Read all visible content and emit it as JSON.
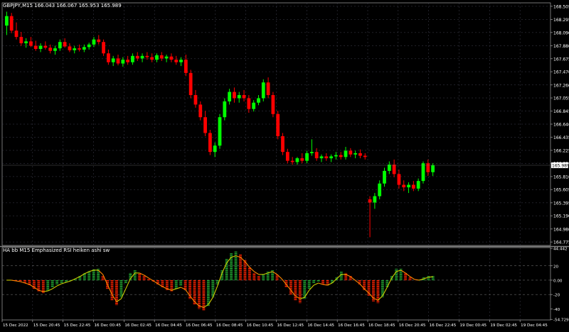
{
  "chart_data": [
    {
      "type": "candlestick",
      "title": "GBPJPY,M15  166.043 166.067 165.953 165.989",
      "ylim": [
        164.72,
        168.56
      ],
      "y_ticks": [
        "168.505",
        "168.295",
        "168.090",
        "167.880",
        "167.675",
        "167.470",
        "167.260",
        "167.055",
        "166.845",
        "166.640",
        "166.435",
        "166.225",
        "166.020",
        "165.810",
        "165.605",
        "165.395",
        "165.190",
        "164.980",
        "164.775"
      ],
      "current_price": "165.989",
      "candles": [
        {
          "o": 168.2,
          "h": 168.42,
          "l": 168.05,
          "c": 168.35
        },
        {
          "o": 168.35,
          "h": 168.4,
          "l": 168.08,
          "c": 168.12
        },
        {
          "o": 168.12,
          "h": 168.25,
          "l": 167.98,
          "c": 168.02
        },
        {
          "o": 168.02,
          "h": 168.1,
          "l": 167.88,
          "c": 167.92
        },
        {
          "o": 167.92,
          "h": 168.0,
          "l": 167.85,
          "c": 167.95
        },
        {
          "o": 167.95,
          "h": 168.02,
          "l": 167.86,
          "c": 167.88
        },
        {
          "o": 167.88,
          "h": 167.96,
          "l": 167.8,
          "c": 167.83
        },
        {
          "o": 167.83,
          "h": 167.92,
          "l": 167.78,
          "c": 167.88
        },
        {
          "o": 167.88,
          "h": 167.95,
          "l": 167.82,
          "c": 167.85
        },
        {
          "o": 167.85,
          "h": 167.9,
          "l": 167.76,
          "c": 167.8
        },
        {
          "o": 167.8,
          "h": 167.88,
          "l": 167.74,
          "c": 167.84
        },
        {
          "o": 167.84,
          "h": 167.98,
          "l": 167.8,
          "c": 167.94
        },
        {
          "o": 167.94,
          "h": 168.0,
          "l": 167.85,
          "c": 167.87
        },
        {
          "o": 167.87,
          "h": 167.92,
          "l": 167.78,
          "c": 167.81
        },
        {
          "o": 167.81,
          "h": 167.88,
          "l": 167.76,
          "c": 167.84
        },
        {
          "o": 167.84,
          "h": 167.9,
          "l": 167.79,
          "c": 167.82
        },
        {
          "o": 167.82,
          "h": 167.9,
          "l": 167.78,
          "c": 167.86
        },
        {
          "o": 167.86,
          "h": 167.93,
          "l": 167.82,
          "c": 167.9
        },
        {
          "o": 167.9,
          "h": 168.02,
          "l": 167.86,
          "c": 167.98
        },
        {
          "o": 167.98,
          "h": 168.05,
          "l": 167.9,
          "c": 167.94
        },
        {
          "o": 167.94,
          "h": 167.98,
          "l": 167.72,
          "c": 167.76
        },
        {
          "o": 167.76,
          "h": 167.82,
          "l": 167.58,
          "c": 167.62
        },
        {
          "o": 167.62,
          "h": 167.72,
          "l": 167.56,
          "c": 167.68
        },
        {
          "o": 167.68,
          "h": 167.74,
          "l": 167.57,
          "c": 167.6
        },
        {
          "o": 167.6,
          "h": 167.7,
          "l": 167.55,
          "c": 167.66
        },
        {
          "o": 167.66,
          "h": 167.72,
          "l": 167.58,
          "c": 167.62
        },
        {
          "o": 167.62,
          "h": 167.76,
          "l": 167.58,
          "c": 167.72
        },
        {
          "o": 167.72,
          "h": 167.78,
          "l": 167.64,
          "c": 167.68
        },
        {
          "o": 167.68,
          "h": 167.76,
          "l": 167.62,
          "c": 167.72
        },
        {
          "o": 167.72,
          "h": 167.78,
          "l": 167.66,
          "c": 167.7
        },
        {
          "o": 167.7,
          "h": 167.76,
          "l": 167.62,
          "c": 167.66
        },
        {
          "o": 167.66,
          "h": 167.76,
          "l": 167.62,
          "c": 167.73
        },
        {
          "o": 167.73,
          "h": 167.78,
          "l": 167.64,
          "c": 167.68
        },
        {
          "o": 167.68,
          "h": 167.74,
          "l": 167.62,
          "c": 167.71
        },
        {
          "o": 167.71,
          "h": 167.76,
          "l": 167.62,
          "c": 167.66
        },
        {
          "o": 167.66,
          "h": 167.72,
          "l": 167.58,
          "c": 167.62
        },
        {
          "o": 167.62,
          "h": 167.7,
          "l": 167.56,
          "c": 167.66
        },
        {
          "o": 167.66,
          "h": 167.74,
          "l": 167.4,
          "c": 167.45
        },
        {
          "o": 167.45,
          "h": 167.5,
          "l": 167.05,
          "c": 167.1
        },
        {
          "o": 167.1,
          "h": 167.18,
          "l": 166.9,
          "c": 166.95
        },
        {
          "o": 166.95,
          "h": 167.0,
          "l": 166.7,
          "c": 166.75
        },
        {
          "o": 166.75,
          "h": 166.85,
          "l": 166.45,
          "c": 166.5
        },
        {
          "o": 166.5,
          "h": 166.55,
          "l": 166.15,
          "c": 166.2
        },
        {
          "o": 166.2,
          "h": 166.35,
          "l": 166.12,
          "c": 166.3
        },
        {
          "o": 166.3,
          "h": 166.8,
          "l": 166.25,
          "c": 166.75
        },
        {
          "o": 166.75,
          "h": 167.05,
          "l": 166.7,
          "c": 167.0
        },
        {
          "o": 167.0,
          "h": 167.2,
          "l": 166.95,
          "c": 167.15
        },
        {
          "o": 167.15,
          "h": 167.22,
          "l": 166.98,
          "c": 167.05
        },
        {
          "o": 167.05,
          "h": 167.15,
          "l": 166.98,
          "c": 167.1
        },
        {
          "o": 167.1,
          "h": 167.18,
          "l": 167.0,
          "c": 167.05
        },
        {
          "o": 167.05,
          "h": 167.1,
          "l": 166.82,
          "c": 166.88
        },
        {
          "o": 166.88,
          "h": 167.02,
          "l": 166.84,
          "c": 166.98
        },
        {
          "o": 166.98,
          "h": 167.1,
          "l": 166.94,
          "c": 167.05
        },
        {
          "o": 167.05,
          "h": 167.35,
          "l": 167.0,
          "c": 167.3
        },
        {
          "o": 167.3,
          "h": 167.38,
          "l": 167.05,
          "c": 167.1
        },
        {
          "o": 167.1,
          "h": 167.15,
          "l": 166.75,
          "c": 166.8
        },
        {
          "o": 166.8,
          "h": 166.85,
          "l": 166.4,
          "c": 166.45
        },
        {
          "o": 166.45,
          "h": 166.5,
          "l": 166.15,
          "c": 166.2
        },
        {
          "o": 166.2,
          "h": 166.25,
          "l": 166.02,
          "c": 166.06
        },
        {
          "o": 166.06,
          "h": 166.12,
          "l": 166.0,
          "c": 166.04
        },
        {
          "o": 166.04,
          "h": 166.12,
          "l": 166.0,
          "c": 166.1
        },
        {
          "o": 166.1,
          "h": 166.18,
          "l": 166.02,
          "c": 166.06
        },
        {
          "o": 166.06,
          "h": 166.22,
          "l": 166.02,
          "c": 166.18
        },
        {
          "o": 166.18,
          "h": 166.4,
          "l": 166.14,
          "c": 166.2
        },
        {
          "o": 166.2,
          "h": 166.26,
          "l": 166.06,
          "c": 166.1
        },
        {
          "o": 166.1,
          "h": 166.16,
          "l": 166.04,
          "c": 166.13
        },
        {
          "o": 166.13,
          "h": 166.18,
          "l": 166.06,
          "c": 166.1
        },
        {
          "o": 166.1,
          "h": 166.16,
          "l": 166.04,
          "c": 166.13
        },
        {
          "o": 166.13,
          "h": 166.2,
          "l": 166.08,
          "c": 166.15
        },
        {
          "o": 166.15,
          "h": 166.2,
          "l": 166.08,
          "c": 166.12
        },
        {
          "o": 166.12,
          "h": 166.28,
          "l": 166.08,
          "c": 166.22
        },
        {
          "o": 166.22,
          "h": 166.26,
          "l": 166.12,
          "c": 166.16
        },
        {
          "o": 166.16,
          "h": 166.22,
          "l": 166.1,
          "c": 166.18
        },
        {
          "o": 166.18,
          "h": 166.24,
          "l": 166.1,
          "c": 166.14
        },
        {
          "o": 166.14,
          "h": 166.18,
          "l": 166.08,
          "c": 166.12
        },
        {
          "o": 165.45,
          "h": 165.5,
          "l": 164.85,
          "c": 165.4
        },
        {
          "o": 165.4,
          "h": 165.55,
          "l": 165.3,
          "c": 165.5
        },
        {
          "o": 165.5,
          "h": 165.75,
          "l": 165.45,
          "c": 165.7
        },
        {
          "o": 165.7,
          "h": 165.95,
          "l": 165.65,
          "c": 165.9
        },
        {
          "o": 165.9,
          "h": 166.05,
          "l": 165.85,
          "c": 166.0
        },
        {
          "o": 166.0,
          "h": 166.08,
          "l": 165.8,
          "c": 165.85
        },
        {
          "o": 165.85,
          "h": 165.92,
          "l": 165.62,
          "c": 165.68
        },
        {
          "o": 165.68,
          "h": 165.75,
          "l": 165.58,
          "c": 165.64
        },
        {
          "o": 165.64,
          "h": 165.72,
          "l": 165.55,
          "c": 165.68
        },
        {
          "o": 165.68,
          "h": 165.74,
          "l": 165.58,
          "c": 165.62
        },
        {
          "o": 165.62,
          "h": 165.78,
          "l": 165.58,
          "c": 165.74
        },
        {
          "o": 165.74,
          "h": 166.05,
          "l": 165.7,
          "c": 166.02
        },
        {
          "o": 166.02,
          "h": 166.08,
          "l": 165.82,
          "c": 165.88
        },
        {
          "o": 165.88,
          "h": 166.02,
          "l": 165.82,
          "c": 165.99
        }
      ],
      "colors": {
        "up": "#00ff00",
        "down": "#ff0000",
        "axis": "#ffffff",
        "grid": "#404050"
      }
    },
    {
      "type": "line",
      "title": "HA bb M15 Emphasized RSI heiken ashi sw",
      "ylim": [
        -55.5,
        45.5
      ],
      "y_ticks": [
        {
          "value": 44.442,
          "label": "44.442"
        },
        {
          "value": 20,
          "label": "20"
        },
        {
          "value": 0,
          "label": "0.00"
        },
        {
          "value": -20,
          "label": "-20"
        },
        {
          "value": -40,
          "label": "-40"
        },
        {
          "value": -54.7291,
          "label": "-54.7291"
        }
      ],
      "levels": [
        20,
        0,
        -20
      ],
      "series": [
        {
          "values": [
            0,
            0,
            -1,
            -2,
            -4,
            -7,
            -12,
            -16,
            -18,
            -15,
            -10,
            -6,
            -4,
            -3,
            -1,
            2,
            6,
            10,
            13,
            15,
            16,
            6,
            -12,
            -28,
            -35,
            -24,
            -4,
            10,
            14,
            10,
            6,
            2,
            -2,
            -6,
            -10,
            -14,
            -16,
            -12,
            -8,
            -14,
            -26,
            -34,
            -40,
            -42,
            -36,
            -24,
            -6,
            14,
            30,
            38,
            40,
            36,
            28,
            18,
            10,
            6,
            8,
            12,
            14,
            8,
            0,
            -10,
            -20,
            -28,
            -32,
            -26,
            -12,
            -4,
            -2,
            -6,
            -8,
            -4,
            4,
            12,
            10,
            6,
            0,
            -6,
            -14,
            -22,
            -30,
            -32,
            -24,
            -10,
            6,
            16,
            16,
            10,
            4,
            0,
            0,
            4,
            6,
            6
          ],
          "colors": {
            "up": "#22aa33",
            "down": "#ff2200"
          }
        },
        {
          "values": [
            0,
            0,
            -1,
            -2,
            -4,
            -6,
            -10,
            -14,
            -16,
            -15,
            -12,
            -8,
            -5,
            -3,
            -1,
            2,
            5,
            9,
            12,
            14,
            14,
            8,
            -6,
            -20,
            -30,
            -26,
            -12,
            2,
            10,
            10,
            7,
            3,
            -1,
            -5,
            -9,
            -12,
            -14,
            -12,
            -10,
            -13,
            -22,
            -30,
            -36,
            -38,
            -34,
            -24,
            -8,
            10,
            24,
            32,
            34,
            32,
            26,
            18,
            12,
            8,
            8,
            10,
            12,
            8,
            2,
            -6,
            -14,
            -22,
            -26,
            -24,
            -14,
            -7,
            -4,
            -6,
            -7,
            -4,
            2,
            8,
            8,
            5,
            0,
            -5,
            -12,
            -18,
            -25,
            -28,
            -22,
            -10,
            3,
            12,
            14,
            10,
            5,
            1,
            0,
            2,
            4,
            5
          ],
          "colors": {
            "up": "#cccc00",
            "down": "#ff8800"
          }
        }
      ],
      "colors": {
        "axis": "#ffffff",
        "level": "#808080"
      }
    }
  ],
  "x_axis": {
    "ticks": [
      "15 Dec 2022",
      "15 Dec 20:45",
      "15 Dec 22:45",
      "16 Dec 00:45",
      "16 Dec 02:45",
      "16 Dec 04:45",
      "16 Dec 06:45",
      "16 Dec 08:45",
      "16 Dec 10:45",
      "16 Dec 12:45",
      "16 Dec 14:45",
      "16 Dec 16:45",
      "16 Dec 18:45",
      "16 Dec 20:45",
      "16 Dec 22:45",
      "19 Dec 00:45",
      "19 Dec 02:45",
      "19 Dec 04:45"
    ]
  }
}
